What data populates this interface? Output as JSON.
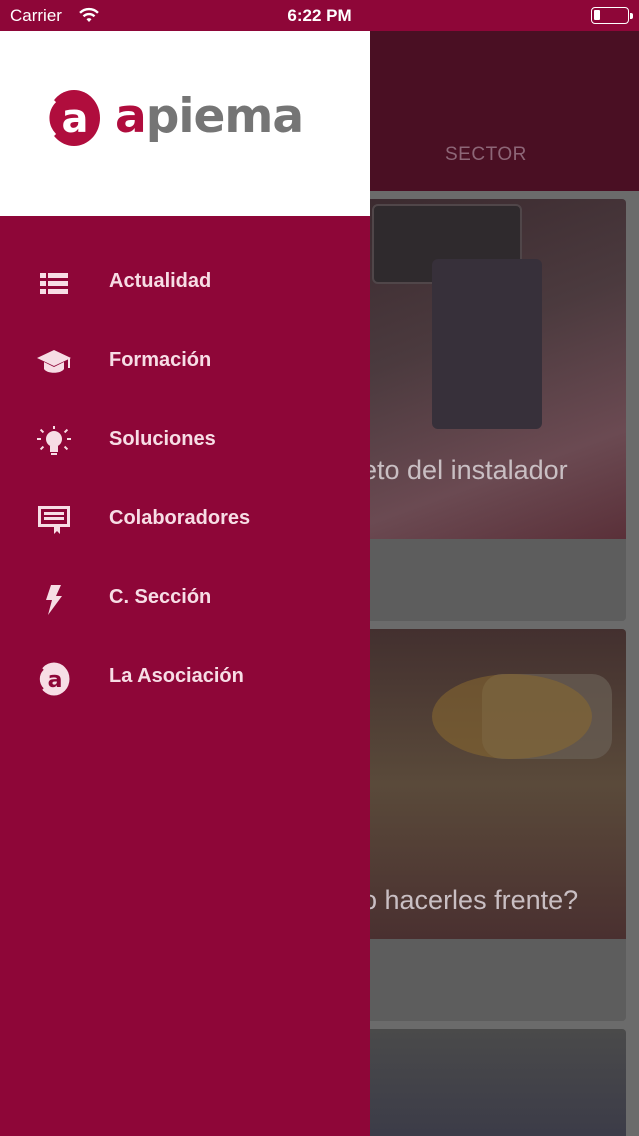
{
  "status_bar": {
    "carrier": "Carrier",
    "time": "6:22 PM",
    "battery_level": 0.2
  },
  "background": {
    "tab_label": "SECTOR",
    "cards": [
      {
        "caption": "eto del instalador"
      },
      {
        "caption": "o hacerles frente?"
      }
    ]
  },
  "drawer": {
    "logo_first_letter": "a",
    "logo_text_rest": "piema",
    "items": [
      {
        "label": "Actualidad",
        "icon": "list-icon"
      },
      {
        "label": "Formación",
        "icon": "graduation-cap-icon"
      },
      {
        "label": "Soluciones",
        "icon": "lightbulb-icon"
      },
      {
        "label": "Colaboradores",
        "icon": "certificate-icon"
      },
      {
        "label": "C. Sección",
        "icon": "lightning-icon"
      },
      {
        "label": "La Asociación",
        "icon": "apiema-logo-icon"
      }
    ]
  },
  "colors": {
    "brand": "#8e0638",
    "brand_logo": "#b00d3d",
    "logo_gray": "#757575",
    "menu_text": "#f7dde5"
  }
}
